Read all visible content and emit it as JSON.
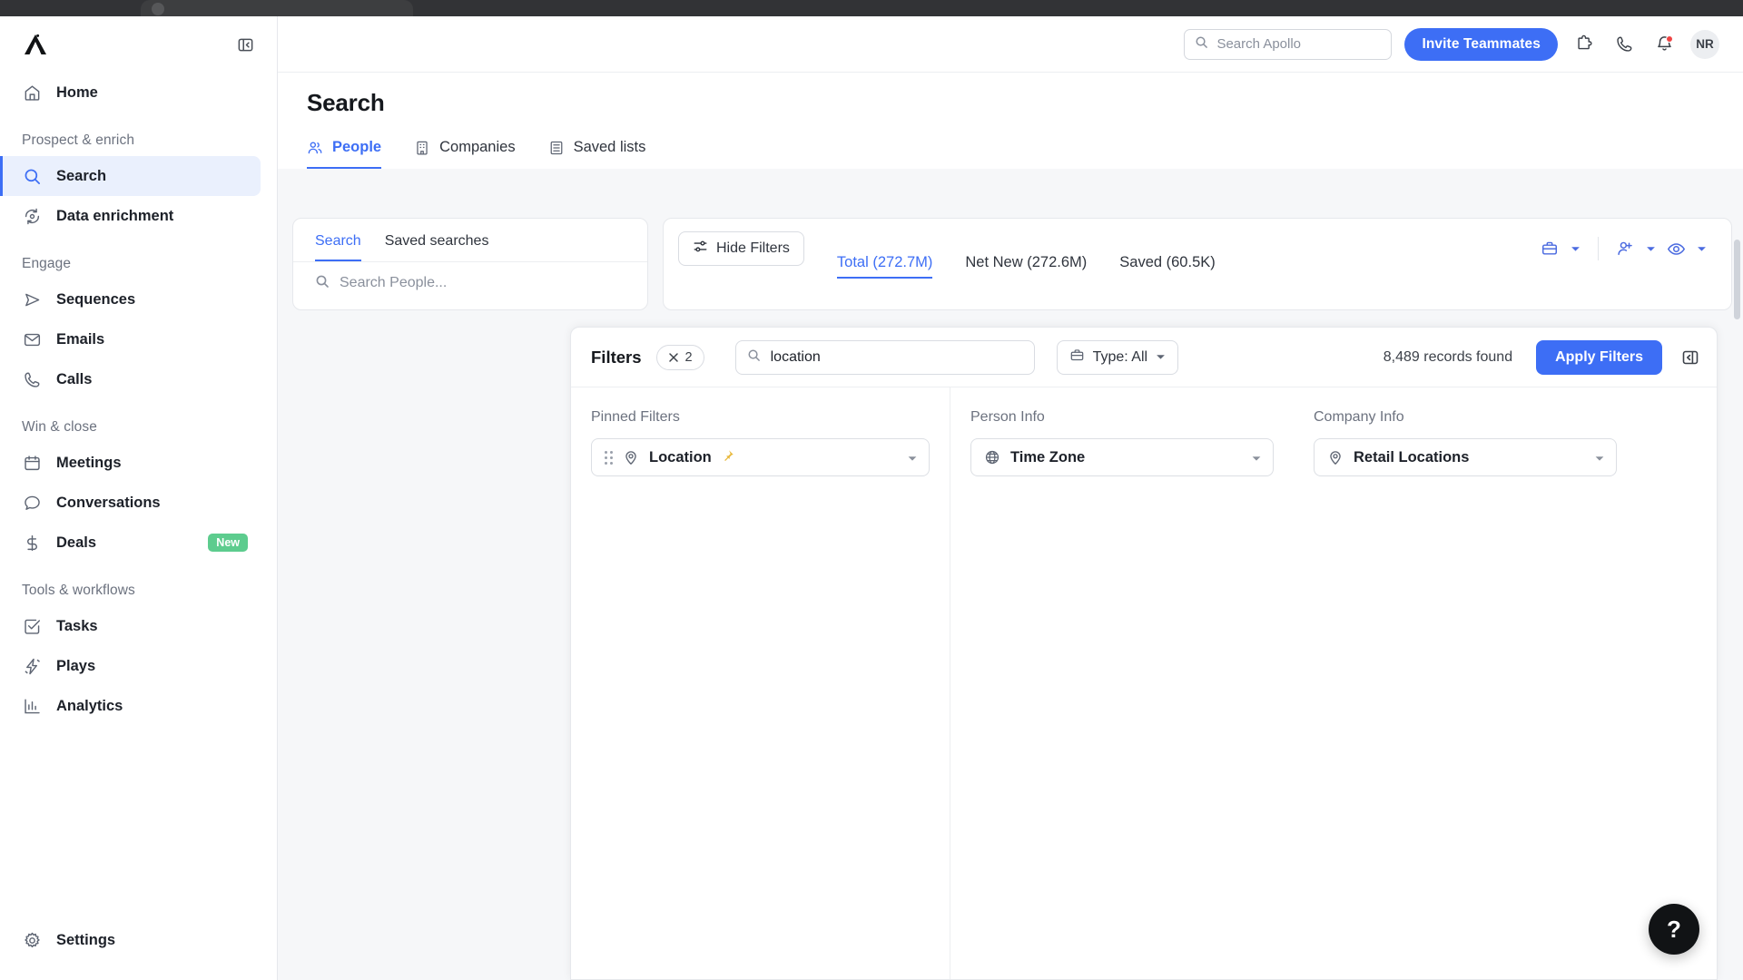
{
  "browser": {
    "chrome_visible": true
  },
  "sidebar": {
    "logo_name": "apollo-logo",
    "collapse_label": "collapse-sidebar",
    "items": [
      {
        "label": "Home",
        "icon": "home-icon",
        "active": false,
        "badge": ""
      }
    ],
    "sections": [
      {
        "label": "Prospect & enrich",
        "items": [
          {
            "label": "Search",
            "icon": "search-icon",
            "active": true,
            "badge": ""
          },
          {
            "label": "Data enrichment",
            "icon": "refresh-data-icon",
            "active": false,
            "badge": ""
          }
        ]
      },
      {
        "label": "Engage",
        "items": [
          {
            "label": "Sequences",
            "icon": "send-icon",
            "active": false,
            "badge": ""
          },
          {
            "label": "Emails",
            "icon": "envelope-icon",
            "active": false,
            "badge": ""
          },
          {
            "label": "Calls",
            "icon": "phone-icon",
            "active": false,
            "badge": ""
          }
        ]
      },
      {
        "label": "Win & close",
        "items": [
          {
            "label": "Meetings",
            "icon": "calendar-icon",
            "active": false,
            "badge": ""
          },
          {
            "label": "Conversations",
            "icon": "chat-bubble-icon",
            "active": false,
            "badge": ""
          },
          {
            "label": "Deals",
            "icon": "dollar-icon",
            "active": false,
            "badge": "New"
          }
        ]
      },
      {
        "label": "Tools & workflows",
        "items": [
          {
            "label": "Tasks",
            "icon": "checkbox-icon",
            "active": false,
            "badge": ""
          },
          {
            "label": "Plays",
            "icon": "lightning-icon",
            "active": false,
            "badge": ""
          },
          {
            "label": "Analytics",
            "icon": "bar-chart-icon",
            "active": false,
            "badge": ""
          }
        ]
      }
    ],
    "settings": {
      "label": "Settings",
      "icon": "gear-icon"
    }
  },
  "topbar": {
    "search_placeholder": "Search Apollo",
    "search_value": "",
    "invite_label": "Invite Teammates",
    "icons": [
      "puzzle-icon",
      "phone-icon",
      "bell-icon"
    ],
    "avatar_initials": "NR",
    "has_notification": true
  },
  "page": {
    "title": "Search",
    "tabs": [
      {
        "label": "People",
        "icon": "people-icon",
        "active": true
      },
      {
        "label": "Companies",
        "icon": "building-icon",
        "active": false
      },
      {
        "label": "Saved lists",
        "icon": "list-icon",
        "active": false
      }
    ]
  },
  "left_panel": {
    "tabs": [
      {
        "label": "Search",
        "active": true
      },
      {
        "label": "Saved searches",
        "active": false
      }
    ],
    "search_placeholder": "Search People...",
    "search_value": ""
  },
  "right_panel": {
    "hide_filters_label": "Hide Filters",
    "count_tabs": [
      {
        "label": "Total (272.7M)",
        "active": true
      },
      {
        "label": "Net New (272.6M)",
        "active": false
      },
      {
        "label": "Saved (60.5K)",
        "active": false
      }
    ],
    "tool_icons": [
      "briefcase-icon",
      "add-person-icon",
      "eye-icon"
    ]
  },
  "filters": {
    "label": "Filters",
    "clear_count": "2",
    "clear_icon": "close-icon",
    "search_value": "location",
    "search_placeholder": "Search filters",
    "type_label": "Type: All",
    "type_icon": "briefcase-icon",
    "records_found": "8,489 records found",
    "apply_label": "Apply Filters",
    "collapse_icon": "collapse-panel-icon",
    "columns": [
      {
        "title": "Pinned Filters",
        "options": [
          {
            "label": "Location",
            "icon": "map-pin-icon",
            "pinned": true,
            "draggable": true
          }
        ]
      },
      {
        "title": "Person Info",
        "options": [
          {
            "label": "Time Zone",
            "icon": "globe-icon",
            "pinned": false,
            "draggable": false
          }
        ]
      },
      {
        "title": "Company Info",
        "options": [
          {
            "label": "Retail Locations",
            "icon": "map-pin-icon",
            "pinned": false,
            "draggable": false
          }
        ]
      }
    ]
  },
  "help": {
    "label": "?",
    "icon": "question-mark-icon"
  },
  "colors": {
    "accent": "#3d6ef5",
    "accent_soft": "#eaf0fd",
    "badge_green": "#5dcc8e",
    "notification_red": "#ef4444",
    "pin_yellow": "#e8b83a",
    "page_bg": "#f6f7f9"
  }
}
